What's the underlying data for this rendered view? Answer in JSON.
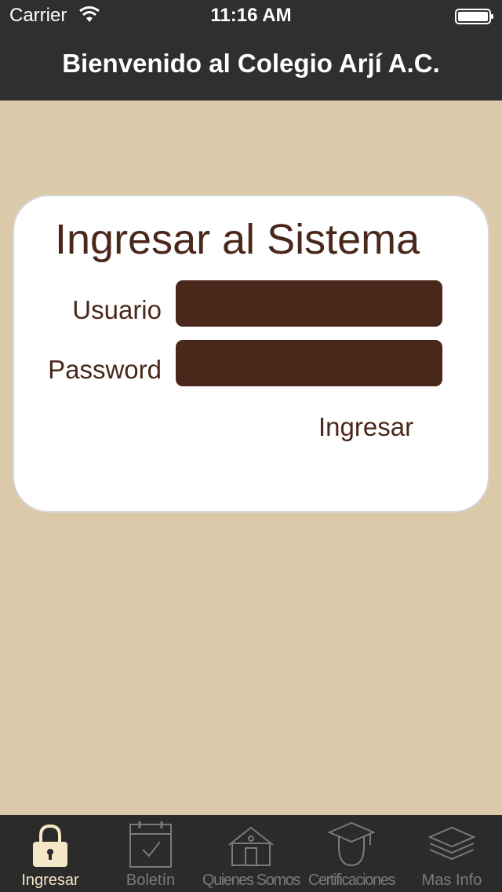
{
  "status_bar": {
    "carrier": "Carrier",
    "time": "11:16 AM",
    "wifi_icon": "wifi-icon",
    "battery_icon": "battery-icon"
  },
  "nav": {
    "title": "Bienvenido al Colegio Arjí A.C."
  },
  "login": {
    "title": "Ingresar al Sistema",
    "user_label": "Usuario",
    "user_value": "",
    "password_label": "Password",
    "password_value": "",
    "submit_label": "Ingresar"
  },
  "tabs": [
    {
      "label": "Ingresar",
      "icon": "lock-icon",
      "active": true
    },
    {
      "label": "Boletín",
      "icon": "calendar-check-icon",
      "active": false
    },
    {
      "label": "Quienes Somos",
      "icon": "school-building-icon",
      "active": false
    },
    {
      "label": "Certificaciones",
      "icon": "graduate-icon",
      "active": false
    },
    {
      "label": "Mas Info",
      "icon": "layers-icon",
      "active": false
    }
  ],
  "colors": {
    "background": "#dbcaaa",
    "bar": "#2f2f2f",
    "brand_brown": "#4a271b",
    "tab_active": "#f4e6c6",
    "tab_inactive": "#7a7a7a"
  }
}
